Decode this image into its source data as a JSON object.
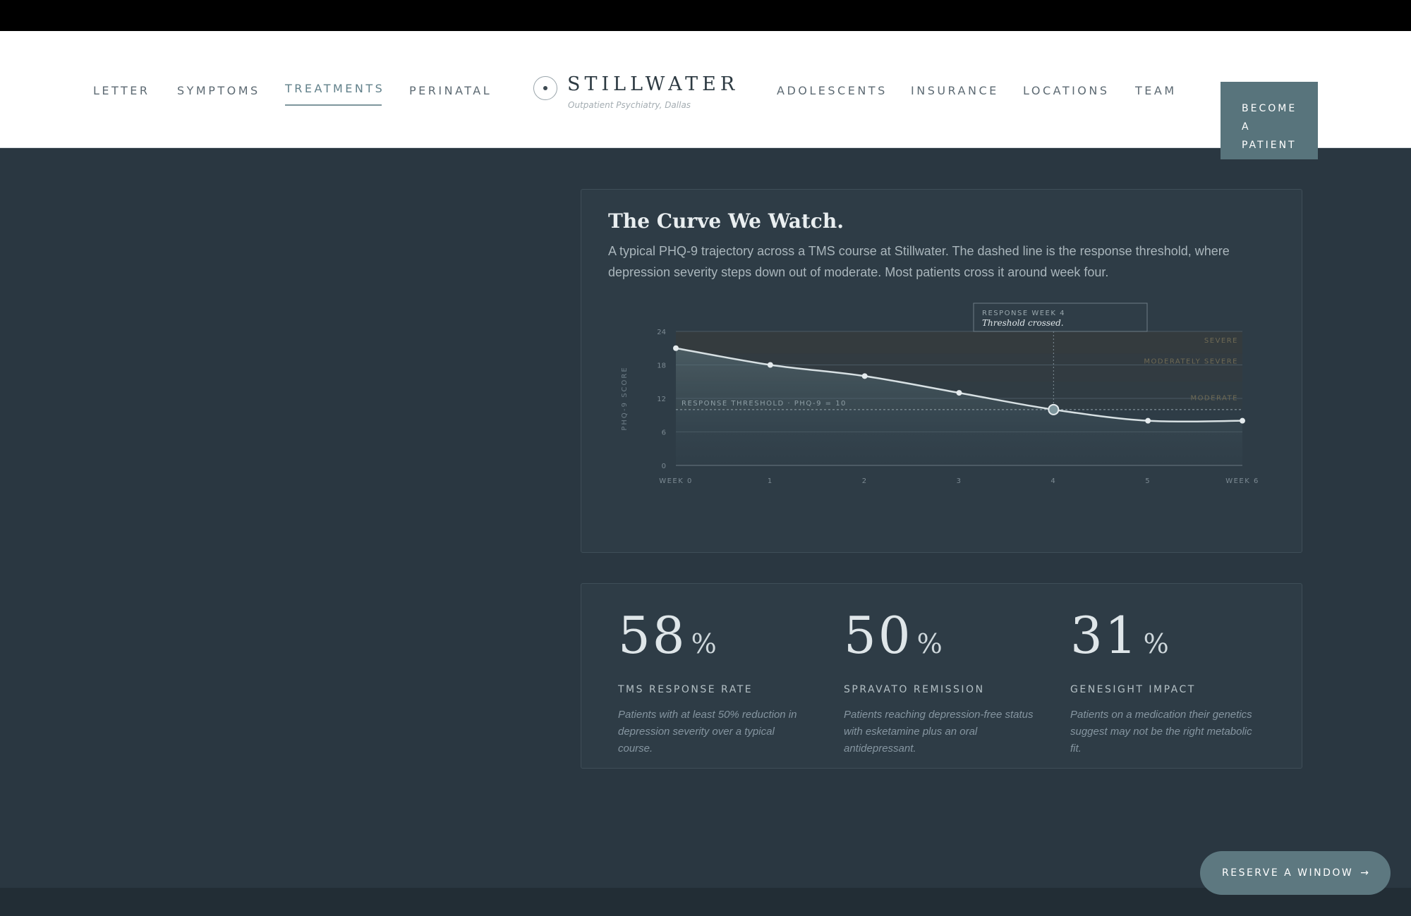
{
  "nav": {
    "left": [
      "LETTER",
      "SYMPTOMS",
      "TREATMENTS",
      "PERINATAL"
    ],
    "right": [
      "ADOLESCENTS",
      "INSURANCE",
      "LOCATIONS",
      "TEAM"
    ],
    "active": "TREATMENTS"
  },
  "logo": {
    "name": "STILLWATER",
    "tagline": "Outpatient Psychiatry, Dallas"
  },
  "cta": {
    "lines": [
      "BECOME",
      "A",
      "PATIENT"
    ]
  },
  "chart_section": {
    "title": "The Curve We Watch.",
    "description": "A typical PHQ-9 trajectory across a TMS course at Stillwater. The dashed line is the response threshold, where depression severity steps down out of moderate. Most patients cross it around week four."
  },
  "chart_data": {
    "type": "line",
    "x": [
      0,
      1,
      2,
      3,
      4,
      5,
      6
    ],
    "x_tick_labels": [
      "WEEK 0",
      "1",
      "2",
      "3",
      "4",
      "5",
      "WEEK 6"
    ],
    "series": [
      {
        "values": [
          21,
          18,
          16,
          13,
          10,
          8,
          8
        ]
      }
    ],
    "ylabel": "PHQ-9 SCORE",
    "ylim": [
      0,
      24
    ],
    "y_ticks": [
      0,
      6,
      12,
      18,
      24
    ],
    "grid": true,
    "threshold": {
      "value": 10,
      "label": "RESPONSE THRESHOLD · PHQ-9 = 10"
    },
    "bands": [
      {
        "label": "SEVERE",
        "from": 20,
        "to": 24
      },
      {
        "label": "MODERATELY SEVERE",
        "from": 15,
        "to": 20
      },
      {
        "label": "MODERATE",
        "from": 10,
        "to": 15
      }
    ],
    "annotation": {
      "x": 4,
      "heading": "RESPONSE WEEK 4",
      "text": "Threshold crossed."
    },
    "colors": {
      "line": "#d7e0e3",
      "band": "#3a3a38",
      "band_text": "#6f6a54"
    }
  },
  "stats": [
    {
      "value": "58",
      "unit": "%",
      "label": "TMS RESPONSE RATE",
      "desc": "Patients with at least 50% reduction in depression severity over a typical course."
    },
    {
      "value": "50",
      "unit": "%",
      "label": "SPRAVATO REMISSION",
      "desc": "Patients reaching depression-free status with esketamine plus an oral antidepressant."
    },
    {
      "value": "31",
      "unit": "%",
      "label": "GENESIGHT IMPACT",
      "desc": "Patients on a medication their genetics suggest may not be the right metabolic fit."
    }
  ],
  "reserve_button": {
    "label": "RESERVE A WINDOW",
    "arrow": "→"
  },
  "colors": {
    "accent": "#58747c",
    "background": "#2a3741",
    "card": "#2e3c46"
  }
}
